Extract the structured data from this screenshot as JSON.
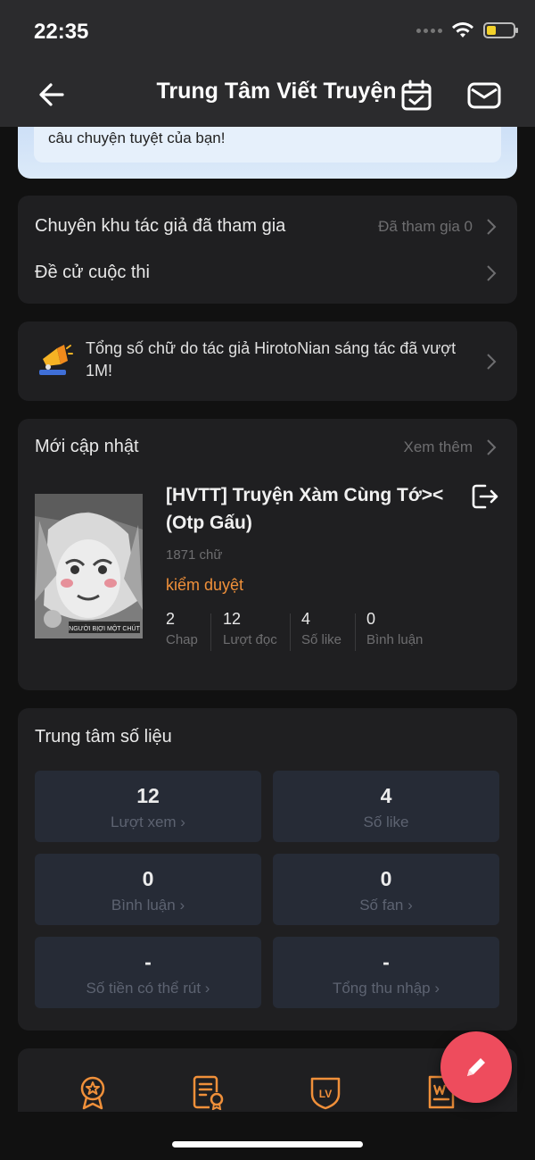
{
  "status_bar": {
    "time": "22:35"
  },
  "header": {
    "title": "Trung Tâm Viết Truyện"
  },
  "banner": {
    "text": "câu chuyện tuyệt của bạn!"
  },
  "menu": {
    "items": [
      {
        "label": "Chuyên khu tác giả đã tham gia",
        "right": "Đã tham gia 0"
      },
      {
        "label": "Đề cử cuộc thi",
        "right": ""
      }
    ]
  },
  "notice": {
    "text": "Tổng số chữ do tác giả HirotoNian sáng tác đã vượt 1M!"
  },
  "recent": {
    "title": "Mới cập nhật",
    "more": "Xem thêm",
    "cover_caption": "NGƯỜI BỊỢI MỘT CHÚT",
    "book": {
      "title": "[HVTT] Truyện Xàm Cùng Tớ>< (Otp Gấu)",
      "words": "1871 chữ",
      "status": "kiểm duyệt",
      "stats": [
        {
          "value": "2",
          "label": "Chap"
        },
        {
          "value": "12",
          "label": "Lượt đọc"
        },
        {
          "value": "4",
          "label": "Số like"
        },
        {
          "value": "0",
          "label": "Bình luận"
        }
      ]
    }
  },
  "metrics": {
    "title": "Trung tâm số liệu",
    "tiles": [
      {
        "value": "12",
        "label": "Lượt xem"
      },
      {
        "value": "4",
        "label": "Số like"
      },
      {
        "value": "0",
        "label": "Bình luận"
      },
      {
        "value": "0",
        "label": "Số fan"
      },
      {
        "value": "-",
        "label": "Số tiền có thể rút"
      },
      {
        "value": "-",
        "label": "Tổng thu nhập"
      }
    ]
  },
  "bottom_tools": {
    "icons": [
      "award-icon",
      "certificate-icon",
      "level-badge-icon",
      "word-document-icon"
    ],
    "level_text": "LV"
  },
  "colors": {
    "accent": "#f0903a",
    "fab": "#ee4c5d",
    "card": "#1f1f21",
    "tile": "#262b36",
    "battery": "#f2d12b"
  }
}
